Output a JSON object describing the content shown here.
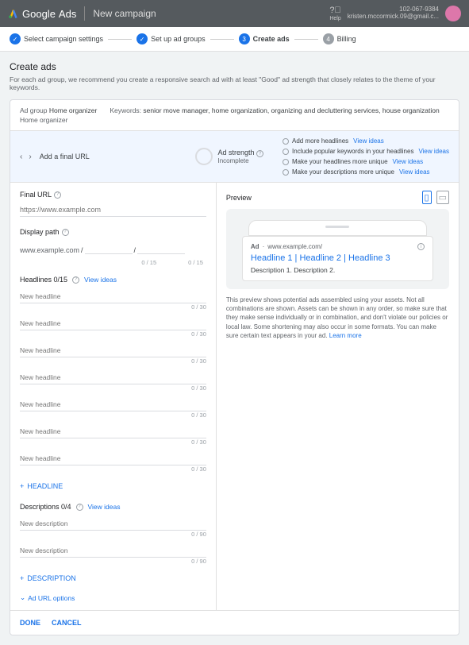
{
  "topbar": {
    "brand1": "Google",
    "brand2": "Ads",
    "page_title": "New campaign",
    "help_label": "Help",
    "account_id": "102-067-9384",
    "account_email": "kristen.mccormick.09@gmail.c..."
  },
  "stepper": {
    "s1": "Select campaign settings",
    "s2": "Set up ad groups",
    "s3_num": "3",
    "s3": "Create ads",
    "s4_num": "4",
    "s4": "Billing"
  },
  "create": {
    "title": "Create ads",
    "subtitle": "For each ad group, we recommend you create a responsive search ad with at least \"Good\" ad strength that closely relates to the theme of your keywords."
  },
  "adgroup": {
    "label": "Ad group",
    "name": "Home organizer",
    "path": "Home organizer",
    "kw_label": "Keywords:",
    "kw_list": "senior move manager, home organization, organizing and decluttering services, house organization"
  },
  "strength": {
    "add_final": "Add a final URL",
    "label": "Ad strength",
    "status": "Incomplete",
    "sg1": "Add more headlines",
    "sg2": "Include popular keywords in your headlines",
    "sg3": "Make your headlines more unique",
    "sg4": "Make your descriptions more unique",
    "view_ideas": "View ideas"
  },
  "form": {
    "final_url_label": "Final URL",
    "final_url_ph": "https://www.example.com",
    "display_path_label": "Display path",
    "display_base": "www.example.com",
    "slash": "/",
    "cnt15": "0 / 15",
    "headlines_label": "Headlines 0/15",
    "view_ideas": "View ideas",
    "new_headline_ph": "New headline",
    "cnt30": "0 / 30",
    "add_headline": "HEADLINE",
    "descriptions_label": "Descriptions 0/4",
    "new_desc_ph": "New description",
    "cnt90": "0 / 90",
    "add_description": "DESCRIPTION",
    "ad_url_options": "Ad URL options"
  },
  "preview": {
    "header": "Preview",
    "ad_tag": "Ad",
    "ad_dot": "·",
    "ad_url": "www.example.com/",
    "ad_headlines": "Headline 1 | Headline 2 | Headline 3",
    "ad_desc": "Description 1. Description 2.",
    "note": "This preview shows potential ads assembled using your assets. Not all combinations are shown. Assets can be shown in any order, so make sure that they make sense individually or in combination, and don't violate our policies or local law. Some shortening may also occur in some formats. You can make sure certain text appears in your ad. ",
    "learn_more": "Learn more"
  },
  "footer": {
    "done": "DONE",
    "cancel": "CANCEL"
  }
}
